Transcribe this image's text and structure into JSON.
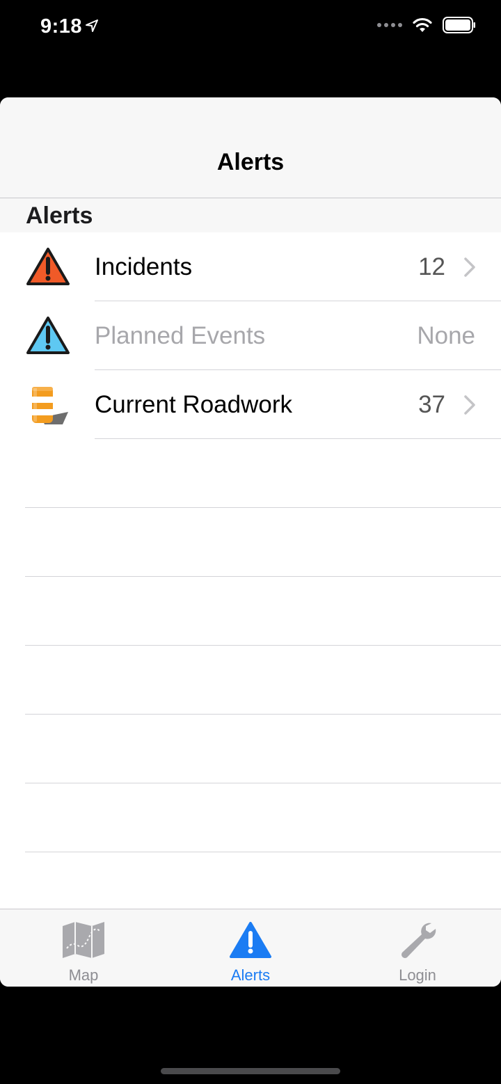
{
  "status_bar": {
    "time": "9:18",
    "icons": [
      "location-arrow-icon",
      "signal-dots-icon",
      "wifi-icon",
      "battery-icon"
    ]
  },
  "navbar": {
    "title": "Alerts"
  },
  "section": {
    "title": "Alerts"
  },
  "rows": [
    {
      "label": "Incidents",
      "value": "12",
      "icon": "incident-warning-icon",
      "enabled": true
    },
    {
      "label": "Planned Events",
      "value": "None",
      "icon": "planned-event-warning-icon",
      "enabled": false
    },
    {
      "label": "Current Roadwork",
      "value": "37",
      "icon": "roadwork-barrel-icon",
      "enabled": true
    }
  ],
  "tabbar": {
    "tabs": [
      {
        "label": "Map",
        "icon": "map-icon",
        "active": false
      },
      {
        "label": "Alerts",
        "icon": "alert-icon",
        "active": true
      },
      {
        "label": "Login",
        "icon": "wrench-icon",
        "active": false
      }
    ]
  },
  "colors": {
    "accent": "#1b7cf3",
    "incident": "#f05a28",
    "planned": "#5ec8f2",
    "roadwork": "#f39c1f"
  }
}
